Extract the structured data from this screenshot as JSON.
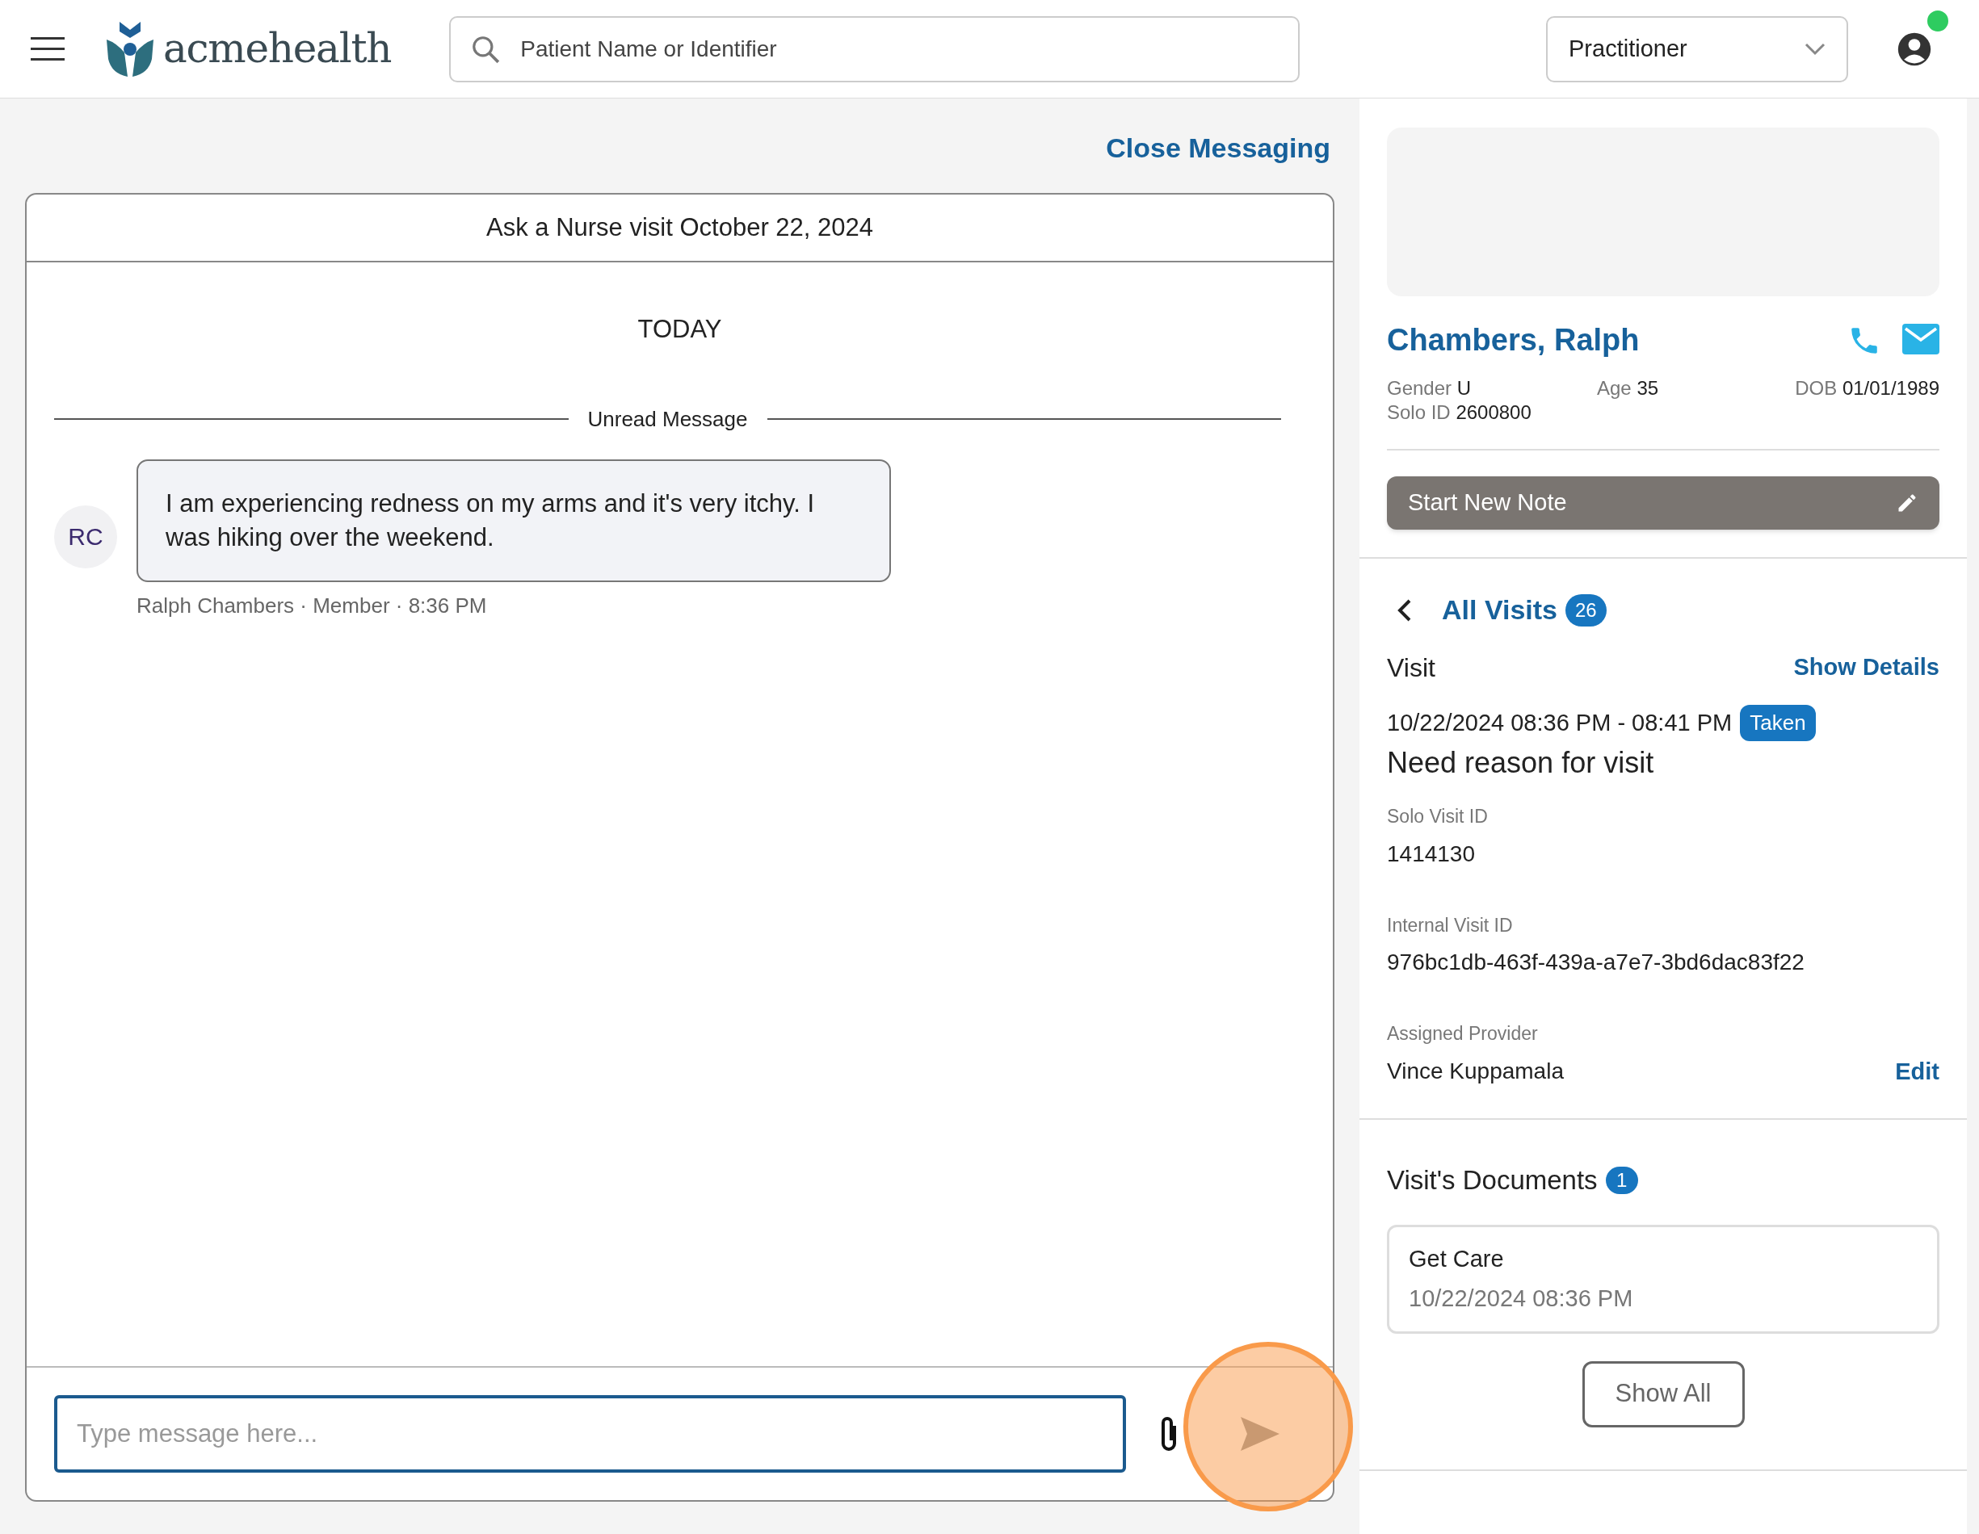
{
  "header": {
    "brand": "acmehealth",
    "search": {
      "placeholder": "Patient Name or Identifier"
    },
    "role_select": {
      "value": "Practitioner"
    },
    "user": {
      "online": true
    }
  },
  "messaging": {
    "close_link": "Close Messaging",
    "title": "Ask a Nurse visit October 22, 2024",
    "day_label": "TODAY",
    "unread_label": "Unread Message",
    "messages": [
      {
        "initials": "RC",
        "text": "I am experiencing redness on my arms and it's very itchy. I was hiking over the weekend.",
        "meta": "Ralph Chambers · Member · 8:36 PM"
      }
    ],
    "composer": {
      "placeholder": "Type message here...",
      "send_highlighted": true
    }
  },
  "patient": {
    "name": "Chambers, Ralph",
    "fields": [
      {
        "label": "Gender",
        "value": "U"
      },
      {
        "label": "Age",
        "value": "35"
      },
      {
        "label": "DOB",
        "value": "01/01/1989"
      },
      {
        "label": "Solo ID",
        "value": "2600800"
      }
    ],
    "note_button": "Start New Note"
  },
  "visits": {
    "back_label": "All Visits",
    "count": "26",
    "section": "Visit",
    "details_link": "Show Details",
    "time": "10/22/2024 08:36 PM - 08:41 PM",
    "status": "Taken",
    "reason": "Need reason for visit",
    "fields": [
      {
        "label": "Solo Visit ID",
        "value": "1414130"
      },
      {
        "label": "Internal Visit ID",
        "value": "976bc1db-463f-439a-a7e7-3bd6dac83f22"
      },
      {
        "label": "Assigned Provider",
        "value": "Vince Kuppamala",
        "action": "Edit"
      }
    ]
  },
  "documents": {
    "title": "Visit's Documents",
    "count": "1",
    "items": [
      {
        "name": "Get Care",
        "date": "10/22/2024 08:36 PM"
      }
    ],
    "show_all": "Show All"
  }
}
